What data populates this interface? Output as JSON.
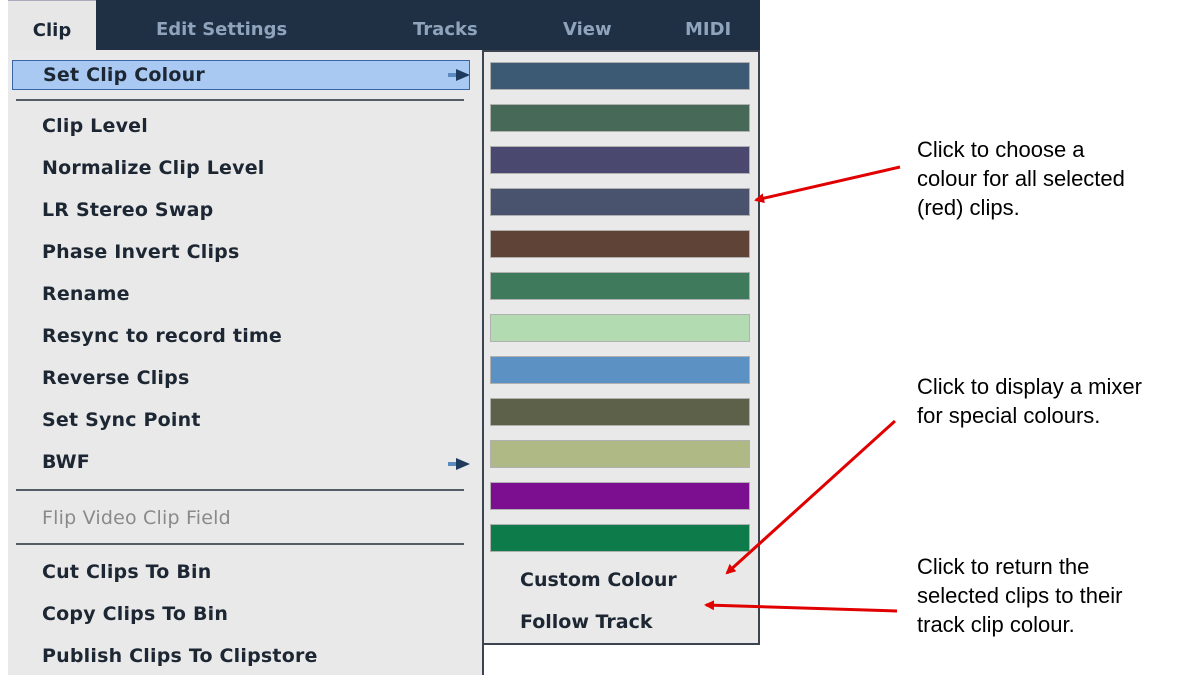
{
  "menubar": {
    "items": [
      {
        "label": "Clip"
      },
      {
        "label": "Edit Settings"
      },
      {
        "label": "Tracks"
      },
      {
        "label": "View"
      },
      {
        "label": "MIDI"
      }
    ]
  },
  "menu": {
    "set_clip_colour": "Set Clip Colour",
    "items": [
      {
        "label": "Clip Level"
      },
      {
        "label": "Normalize Clip Level"
      },
      {
        "label": "LR Stereo Swap"
      },
      {
        "label": "Phase Invert Clips"
      },
      {
        "label": "Rename"
      },
      {
        "label": "Resync to record time"
      },
      {
        "label": "Reverse Clips"
      },
      {
        "label": "Set Sync Point"
      },
      {
        "label": "BWF"
      }
    ],
    "flip_video": "Flip Video Clip Field",
    "bin_items": [
      {
        "label": "Cut  Clips To Bin"
      },
      {
        "label": "Copy Clips To Bin"
      },
      {
        "label": "Publish Clips To Clipstore"
      }
    ]
  },
  "colour_submenu": {
    "swatches": [
      "#3d5a75",
      "#466a57",
      "#4b4870",
      "#4a536e",
      "#5f4336",
      "#3e7a5b",
      "#b2dbb2",
      "#5b91c3",
      "#5d6149",
      "#aeb985",
      "#7b0f8f",
      "#0e7b4b"
    ],
    "custom_colour": "Custom Colour",
    "follow_track": "Follow Track"
  },
  "annotations": {
    "choose_colour": "Click to choose a\ncolour for all selected\n(red) clips.",
    "mixer": "Click to display a mixer\nfor special colours.",
    "return": "Click to return the\nselected clips to their\ntrack clip colour."
  },
  "colors": {
    "menubar_bg": "#1f2f44",
    "highlight": "#a9c9f3",
    "arrow_red": "#e00000"
  }
}
